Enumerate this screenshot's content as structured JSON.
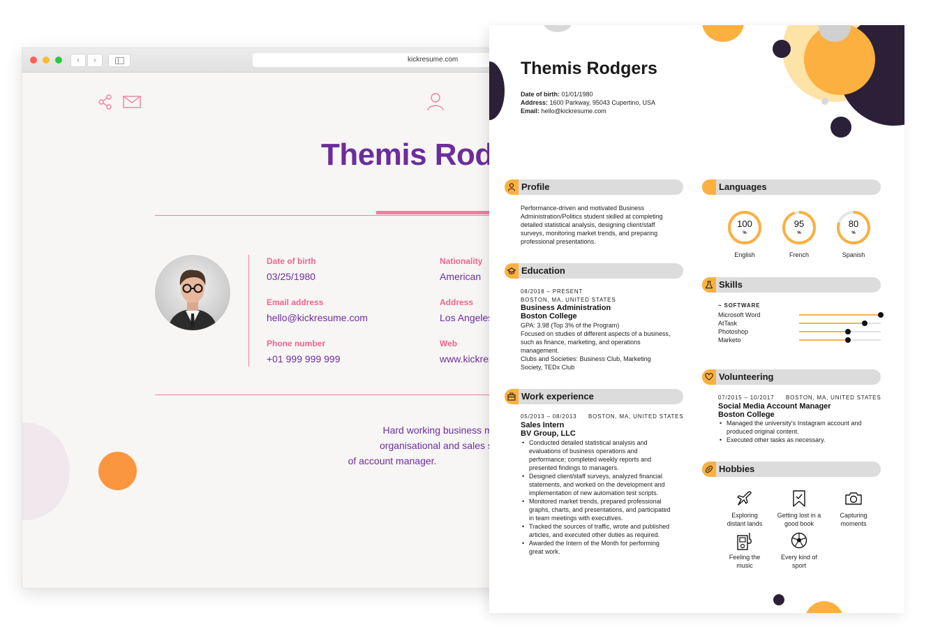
{
  "browser": {
    "url": "kickresume.com"
  },
  "web": {
    "name": "Themis Rodgers",
    "fields": [
      {
        "label": "Date of birth",
        "value": "03/25/1980"
      },
      {
        "label": "Nationality",
        "value": "American"
      },
      {
        "label": "Email address",
        "value": "hello@kickresume.com"
      },
      {
        "label": "Address",
        "value": "Los Angeles, CA"
      },
      {
        "label": "Phone number",
        "value": "+01 999 999 999"
      },
      {
        "label": "Web",
        "value": "www.kickresume.com"
      }
    ],
    "summary_lines": [
      "Hard working business management graduate with great",
      "organisational and sales skills seeking to apply my skills in the position",
      "of account manager."
    ],
    "icons": [
      "share-icon",
      "mail-icon",
      "user-icon"
    ]
  },
  "resume": {
    "name": "Themis Rodgers",
    "info": [
      {
        "label": "Date of birth:",
        "value": "01/01/1980"
      },
      {
        "label": "Address:",
        "value": "1600 Parkway, 95043 Cupertino, USA"
      },
      {
        "label": "Email:",
        "value": "hello@kickresume.com"
      }
    ],
    "accent_color": "#fbb040",
    "dark_color": "#2b2038",
    "sections": {
      "profile": "Profile",
      "education": "Education",
      "work": "Work experience",
      "languages": "Languages",
      "skills": "Skills",
      "volunteering": "Volunteering",
      "hobbies": "Hobbies"
    },
    "profile_lines": [
      "Performance-driven and motivated Business",
      "Administration/Politics student skilled at completing",
      "detailed statistical analysis, designing client/staff",
      "surveys, monitoring market trends, and preparing",
      "professional presentations."
    ],
    "education": {
      "dates": "08/2018 – PRESENT",
      "location": "BOSTON, MA, UNITED STATES",
      "degree": "Business Administration",
      "school": "Boston College",
      "lines": [
        "GPA: 3.98 (Top 3% of the Program)",
        "Focused on studies of different aspects of a business,",
        "such as finance, marketing, and operations",
        "management.",
        "Clubs and Societies: Business Club, Marketing",
        "Society, TEDx Club"
      ]
    },
    "work": {
      "dates": "05/2013 – 08/2013",
      "location": "BOSTON, MA, UNITED STATES",
      "title": "Sales Intern",
      "company": "BV Group, LLC",
      "bullets": [
        [
          "Conducted detailed statistical analysis and",
          "evaluations of business operations and",
          "performance; completed weekly reports and",
          "presented findings to managers."
        ],
        [
          "Designed client/staff surveys, analyzed financial",
          "statements, and worked on the development and",
          "implementation of new automation test scripts."
        ],
        [
          "Monitored market trends, prepared professional",
          "graphs, charts, and presentations, and participated",
          "in team meetings with executives."
        ],
        [
          "Tracked the sources of traffic, wrote and published",
          "articles, and executed other duties as required."
        ],
        [
          "Awarded the Intern of the Month for performing",
          "great work."
        ]
      ]
    },
    "languages": [
      {
        "name": "English",
        "value": "100",
        "unit": "%",
        "level": 1.0
      },
      {
        "name": "French",
        "value": "95",
        "unit": "%",
        "level": 0.95
      },
      {
        "name": "Spanish",
        "value": "80",
        "unit": "%",
        "level": 0.8
      }
    ],
    "skills": {
      "group": "~ SOFTWARE",
      "items": [
        {
          "name": "Microsoft Word",
          "level": 1.0
        },
        {
          "name": "AtTask",
          "level": 0.8
        },
        {
          "name": "Photoshop",
          "level": 0.6
        },
        {
          "name": "Marketo",
          "level": 0.6
        }
      ]
    },
    "volunteering": {
      "dates": "07/2015 – 10/2017",
      "location": "BOSTON, MA, UNITED STATES",
      "title": "Social Media Account Manager",
      "org": "Boston College",
      "bullets": [
        [
          "Managed the university's Instagram account and",
          "produced original content."
        ],
        [
          "Executed other tasks as necessary."
        ]
      ]
    },
    "hobbies": [
      {
        "icon": "plane-icon",
        "label": [
          "Exploring",
          "distant lands"
        ]
      },
      {
        "icon": "bookmark-icon",
        "label": [
          "Getting lost in a",
          "good book"
        ]
      },
      {
        "icon": "camera-icon",
        "label": [
          "Capturing",
          "moments"
        ]
      },
      {
        "icon": "music-player-icon",
        "label": [
          "Feeling the",
          "music"
        ]
      },
      {
        "icon": "soccer-ball-icon",
        "label": [
          "Every kind of",
          "sport"
        ]
      }
    ]
  }
}
